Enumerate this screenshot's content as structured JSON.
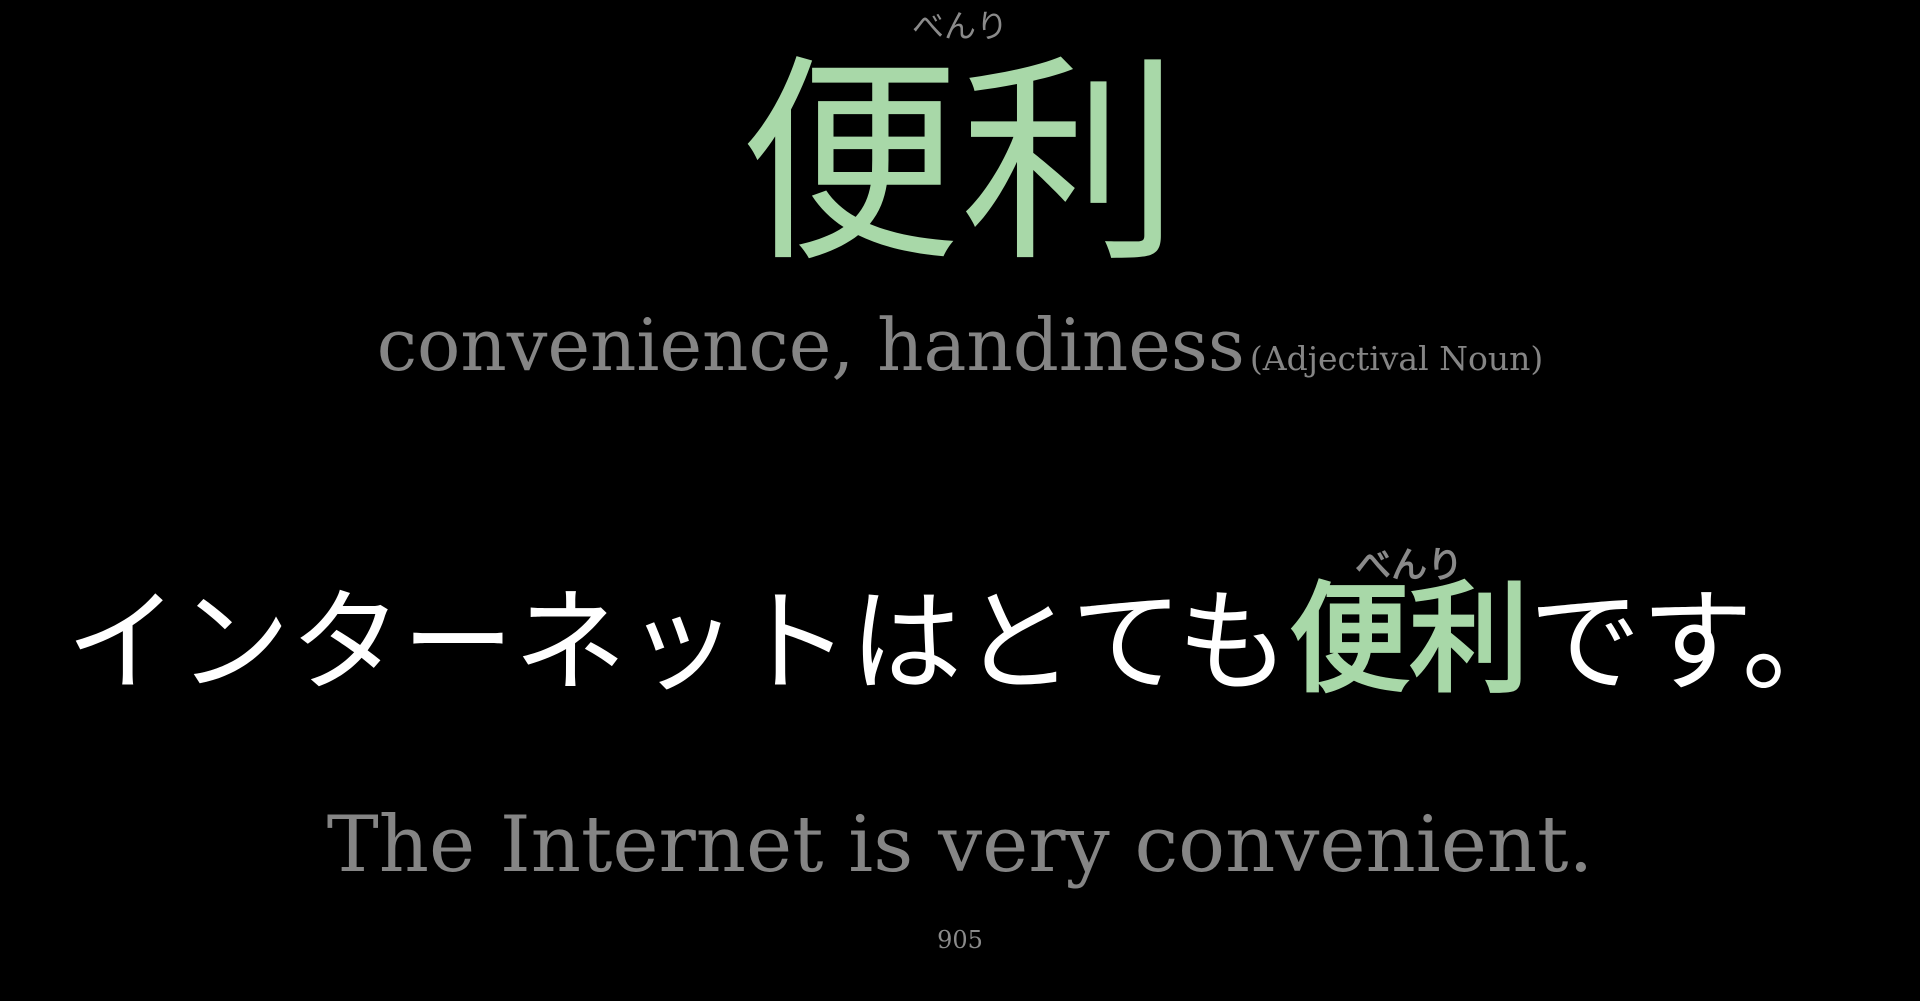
{
  "word": {
    "reading": "べんり",
    "kanji": "便利"
  },
  "meaning": {
    "text": "convenience, handiness",
    "part_of_speech": "(Adjectival Noun)"
  },
  "sentence": {
    "before": "インターネットはとても",
    "highlight": "便利",
    "highlight_reading": "べんり",
    "after": "です。"
  },
  "translation": "The Internet is very convenient.",
  "card_number": "905",
  "colors": {
    "background": "#000000",
    "highlight": "#a8d8a8",
    "sentence_text": "#ffffff",
    "muted_text": "#858585"
  }
}
